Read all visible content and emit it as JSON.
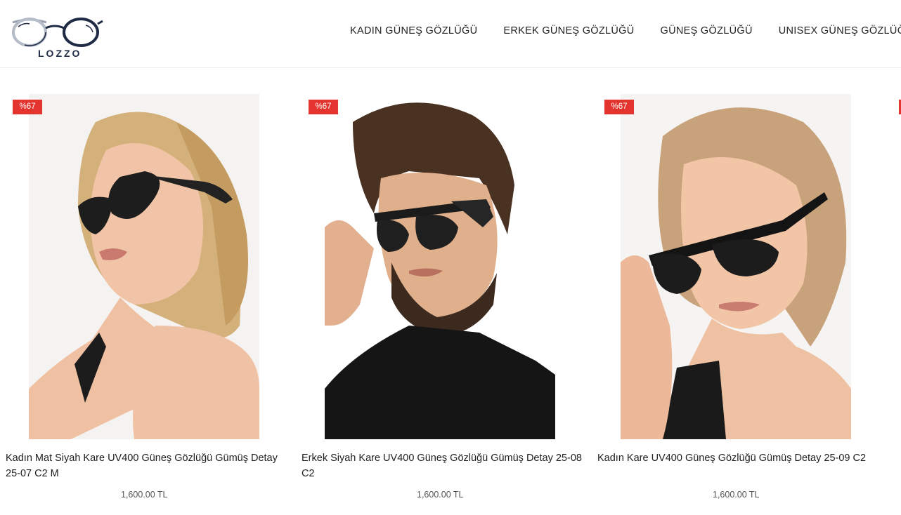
{
  "header": {
    "logo_text": "LOZZO",
    "nav": [
      {
        "label": "KADIN GÜNEŞ GÖZLÜĞÜ"
      },
      {
        "label": "ERKEK GÜNEŞ GÖZLÜĞÜ"
      },
      {
        "label": "GÜNEŞ GÖZLÜĞÜ"
      },
      {
        "label": "UNISEX GÜNEŞ GÖZLÜĞÜ"
      }
    ]
  },
  "products": [
    {
      "badge": "%67",
      "title": "Kadın Mat Siyah Kare UV400 Güneş Gözlüğü Gümüş Detay 25-07 C2 M",
      "price": "1,600.00 TL"
    },
    {
      "badge": "%67",
      "title": "Erkek Siyah Kare UV400 Güneş Gözlüğü Gümüş Detay 25-08 C2",
      "price": "1,600.00 TL"
    },
    {
      "badge": "%67",
      "title": "Kadın Kare UV400 Güneş Gözlüğü Gümüş Detay 25-09 C2",
      "price": "1,600.00 TL"
    }
  ],
  "colors": {
    "badge": "#e3342f",
    "logo": "#1f2a44"
  }
}
